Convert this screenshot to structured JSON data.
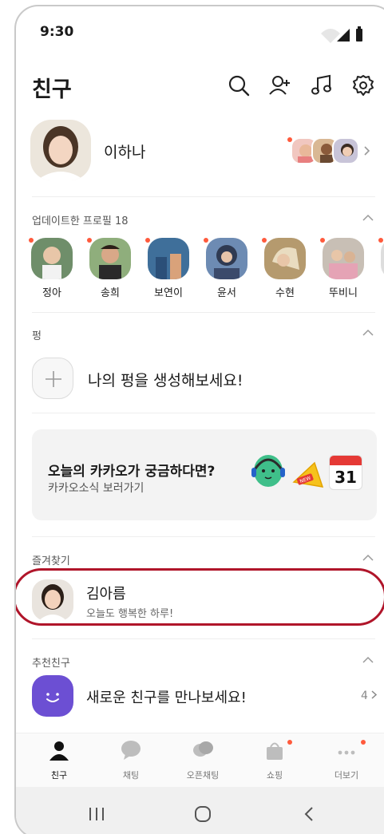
{
  "status": {
    "time": "9:30"
  },
  "header": {
    "title": "친구"
  },
  "me": {
    "name": "이하나"
  },
  "updated": {
    "label": "업데이트한 프로필 18",
    "items": [
      {
        "name": "정아"
      },
      {
        "name": "송희"
      },
      {
        "name": "보연이"
      },
      {
        "name": "윤서"
      },
      {
        "name": "수현"
      },
      {
        "name": "뚜비니"
      }
    ]
  },
  "pyeong": {
    "label": "펑",
    "prompt": "나의 펑을 생성해보세요!"
  },
  "banner": {
    "title": "오늘의 카카오가 궁금하다면?",
    "subtitle": "카카오소식 보러가기",
    "calendar_day": "31",
    "megaphone_text": "NEW"
  },
  "favorites": {
    "label": "즐겨찾기",
    "items": [
      {
        "name": "김아름",
        "status": "오늘도 행복한 하루!"
      }
    ]
  },
  "recommend": {
    "label": "추천친구",
    "text": "새로운 친구를 만나보세요!",
    "count": "4"
  },
  "tabs": [
    {
      "label": "친구"
    },
    {
      "label": "채팅"
    },
    {
      "label": "오픈채팅"
    },
    {
      "label": "쇼핑"
    },
    {
      "label": "더보기"
    }
  ],
  "colors": {
    "accent_dot": "#ff5a3c",
    "highlight": "#b0152a",
    "recommend_bg": "#6c4fd3"
  }
}
